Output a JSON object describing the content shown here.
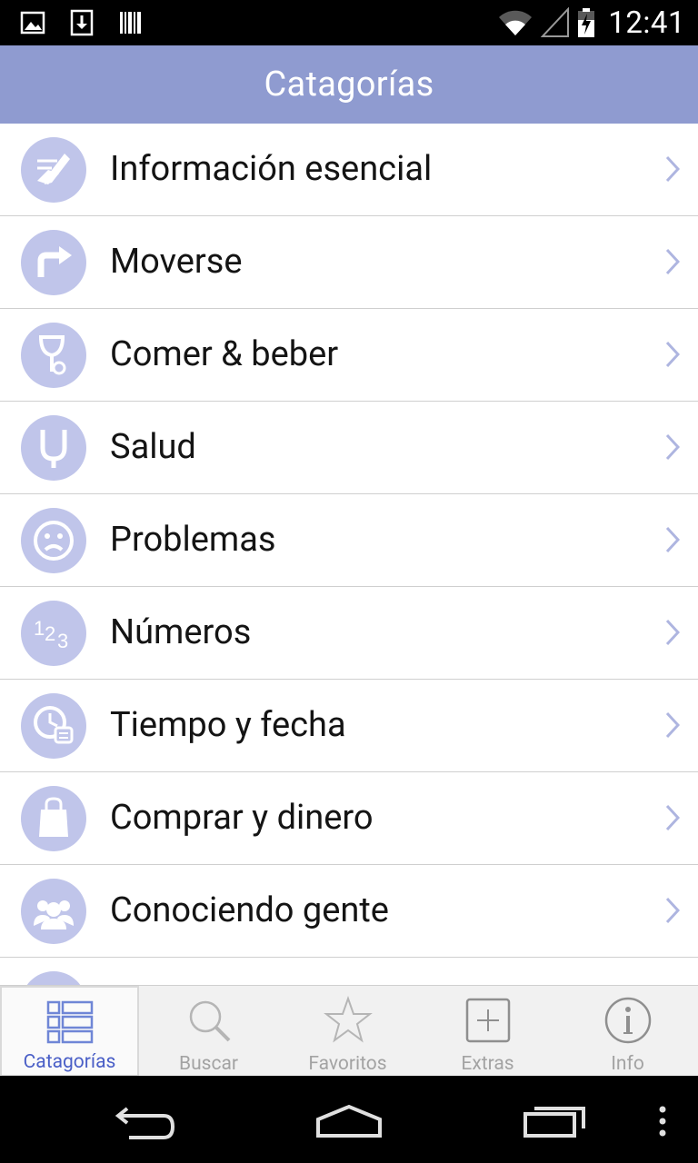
{
  "status": {
    "time": "12:41"
  },
  "header": {
    "title": "Catagorías"
  },
  "categories": [
    {
      "label": "Información esencial",
      "icon": "pencil-note-icon"
    },
    {
      "label": "Moverse",
      "icon": "turn-arrow-icon"
    },
    {
      "label": "Comer & beber",
      "icon": "glass-icon"
    },
    {
      "label": "Salud",
      "icon": "stethoscope-icon"
    },
    {
      "label": "Problemas",
      "icon": "sad-face-icon"
    },
    {
      "label": "Números",
      "icon": "numbers-icon"
    },
    {
      "label": "Tiempo y fecha",
      "icon": "clock-icon"
    },
    {
      "label": "Comprar y dinero",
      "icon": "shopping-bag-icon"
    },
    {
      "label": "Conociendo gente",
      "icon": "people-icon"
    }
  ],
  "tabs": [
    {
      "label": "Catagorías",
      "icon": "list-icon",
      "active": true
    },
    {
      "label": "Buscar",
      "icon": "search-icon"
    },
    {
      "label": "Favoritos",
      "icon": "star-icon"
    },
    {
      "label": "Extras",
      "icon": "plus-box-icon"
    },
    {
      "label": "Info",
      "icon": "info-icon"
    }
  ],
  "colors": {
    "accent": "#8f9bd0",
    "icon_bg": "#c0c5ea",
    "active_tab_text": "#4a5fc7"
  }
}
